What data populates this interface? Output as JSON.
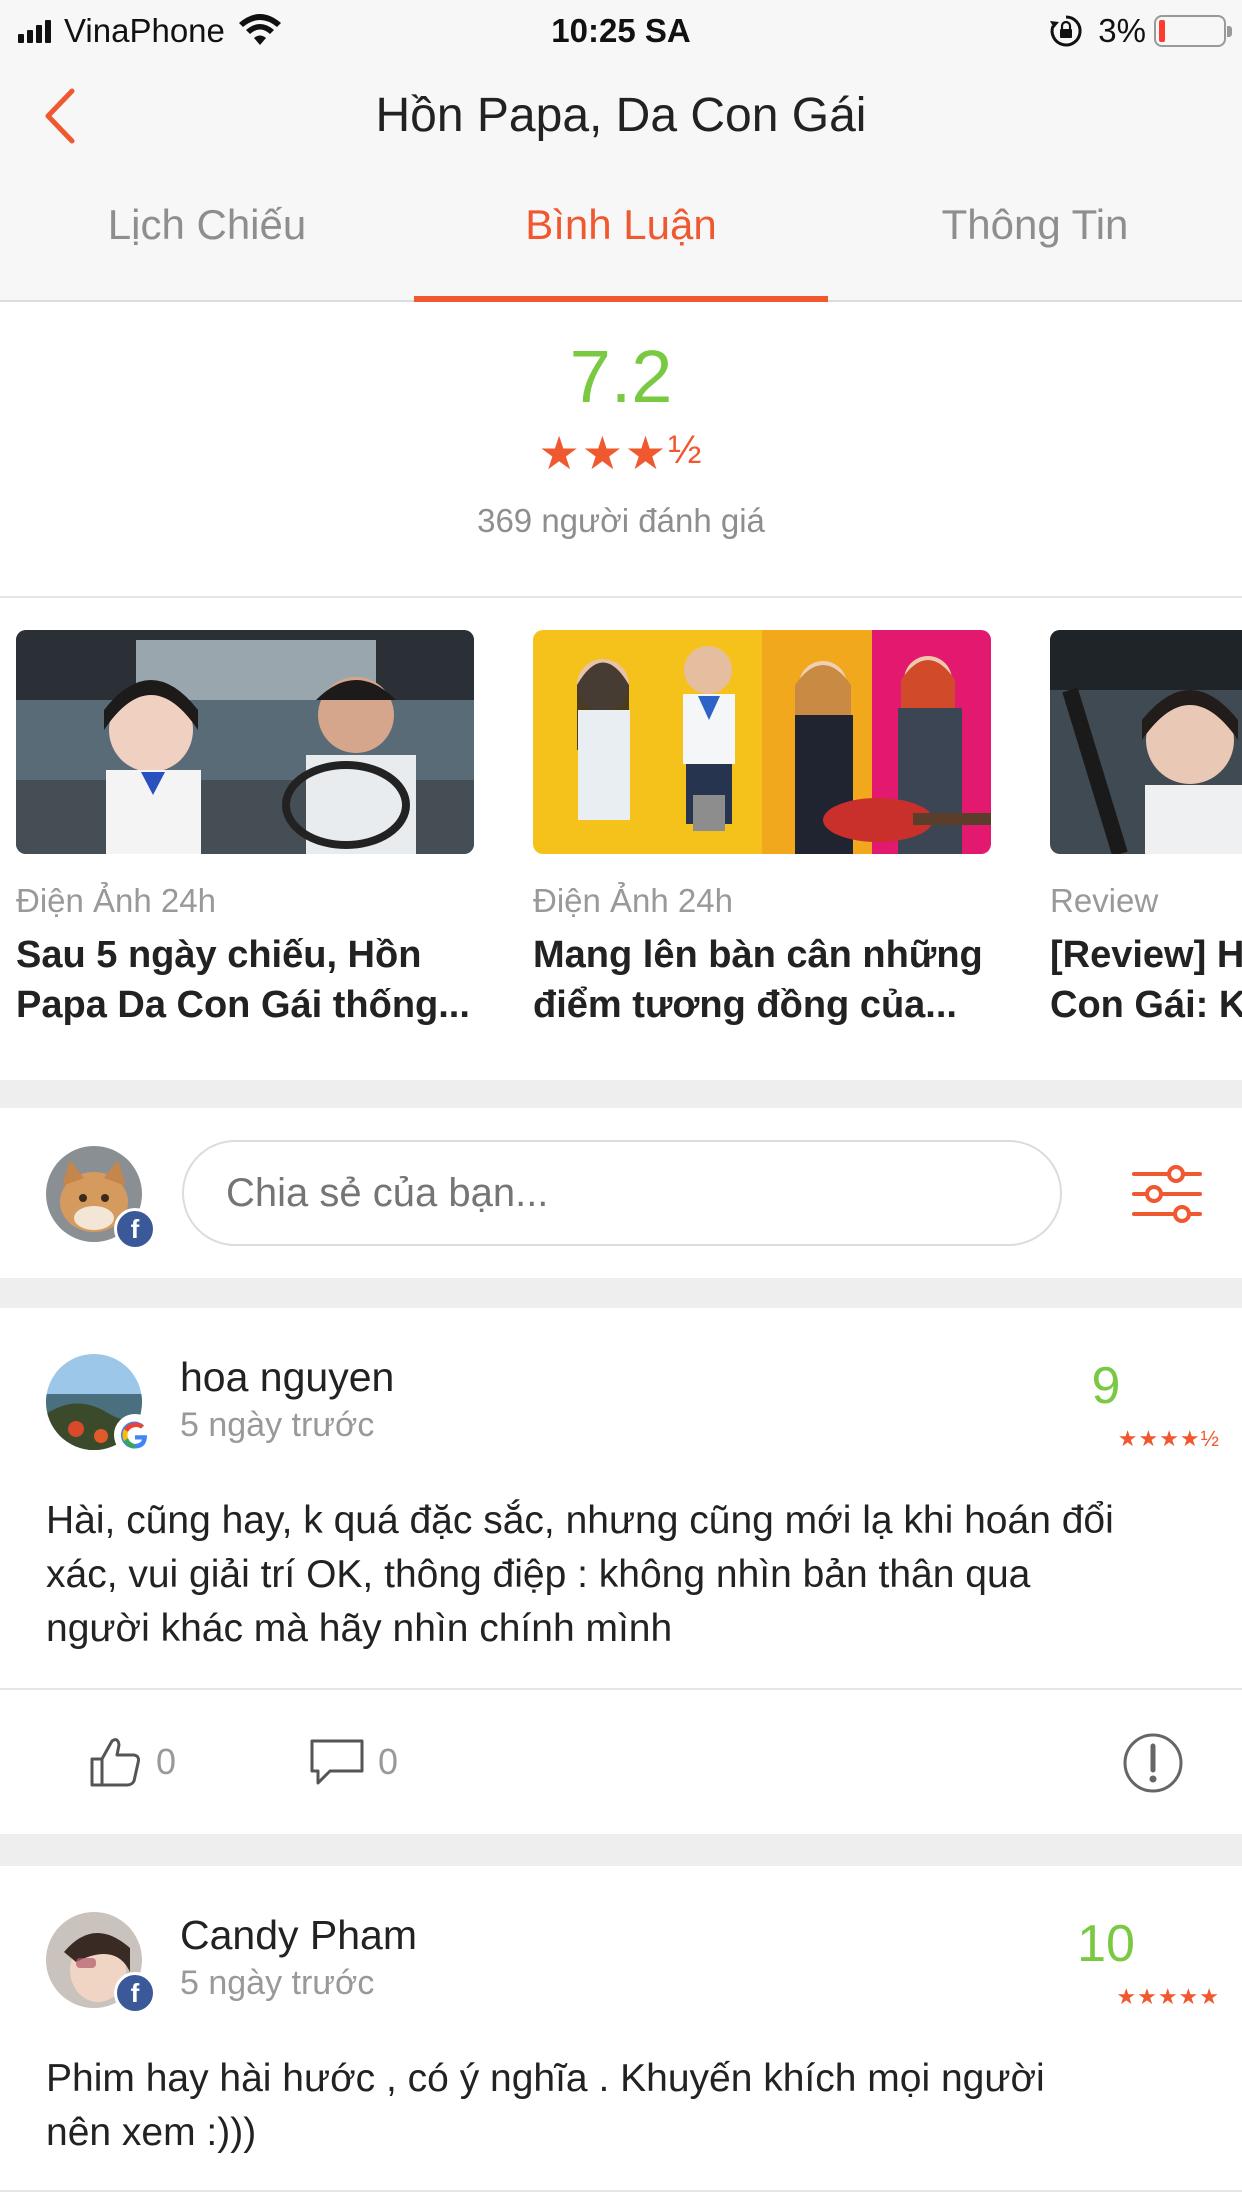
{
  "status_bar": {
    "carrier": "VinaPhone",
    "time": "10:25 SA",
    "battery": "3%",
    "icons": [
      "signal-icon",
      "wifi-icon",
      "rotation-lock-icon",
      "battery-icon"
    ]
  },
  "nav": {
    "title": "Hồn Papa, Da Con Gái",
    "back_icon": "chevron-left-icon"
  },
  "tabs": [
    {
      "label": "Lịch Chiếu",
      "active": false
    },
    {
      "label": "Bình Luận",
      "active": true
    },
    {
      "label": "Thông Tin",
      "active": false
    }
  ],
  "rating": {
    "score": "7.2",
    "stars": 3.5,
    "stars_text": "★★★",
    "half_text": "½",
    "count_text": "369 người đánh giá"
  },
  "news": [
    {
      "source": "Điện Ảnh 24h",
      "title_line1": "Sau 5 ngày chiếu, Hồn",
      "title_line2": "Papa Da Con Gái thống..."
    },
    {
      "source": "Điện Ảnh 24h",
      "title_line1": "Mang lên bàn cân những",
      "title_line2": "điểm tương đồng của..."
    },
    {
      "source": "Review",
      "title_line1": "[Review] H",
      "title_line2": "Con Gái: K"
    }
  ],
  "compose": {
    "placeholder": "Chia sẻ của bạn...",
    "badge": "f",
    "filter_icon": "filter-sliders-icon"
  },
  "comments": [
    {
      "name": "hoa nguyen",
      "time": "5 ngày trước",
      "score": "9",
      "stars_text": "★★★★½",
      "badge": "G",
      "text_line1": "Hài, cũng hay, k quá đặc sắc, nhưng cũng mới lạ khi hoán đổi",
      "text_line2": "xác, vui giải trí OK, thông điệp : không nhìn bản thân qua",
      "text_line3": "người khác mà hãy nhìn chính mình",
      "likes": "0",
      "replies": "0"
    },
    {
      "name": "Candy Pham",
      "time": "5 ngày trước",
      "score": "10",
      "stars_text": "★★★★★",
      "badge": "f",
      "text_line1": "Phim hay hài hước , có ý nghĩa . Khuyến khích mọi người",
      "text_line2": "nên xem :)))"
    }
  ],
  "colors": {
    "accent": "#f0582f",
    "score_green": "#7ac943",
    "muted": "#999999",
    "facebook": "#3b5998"
  }
}
